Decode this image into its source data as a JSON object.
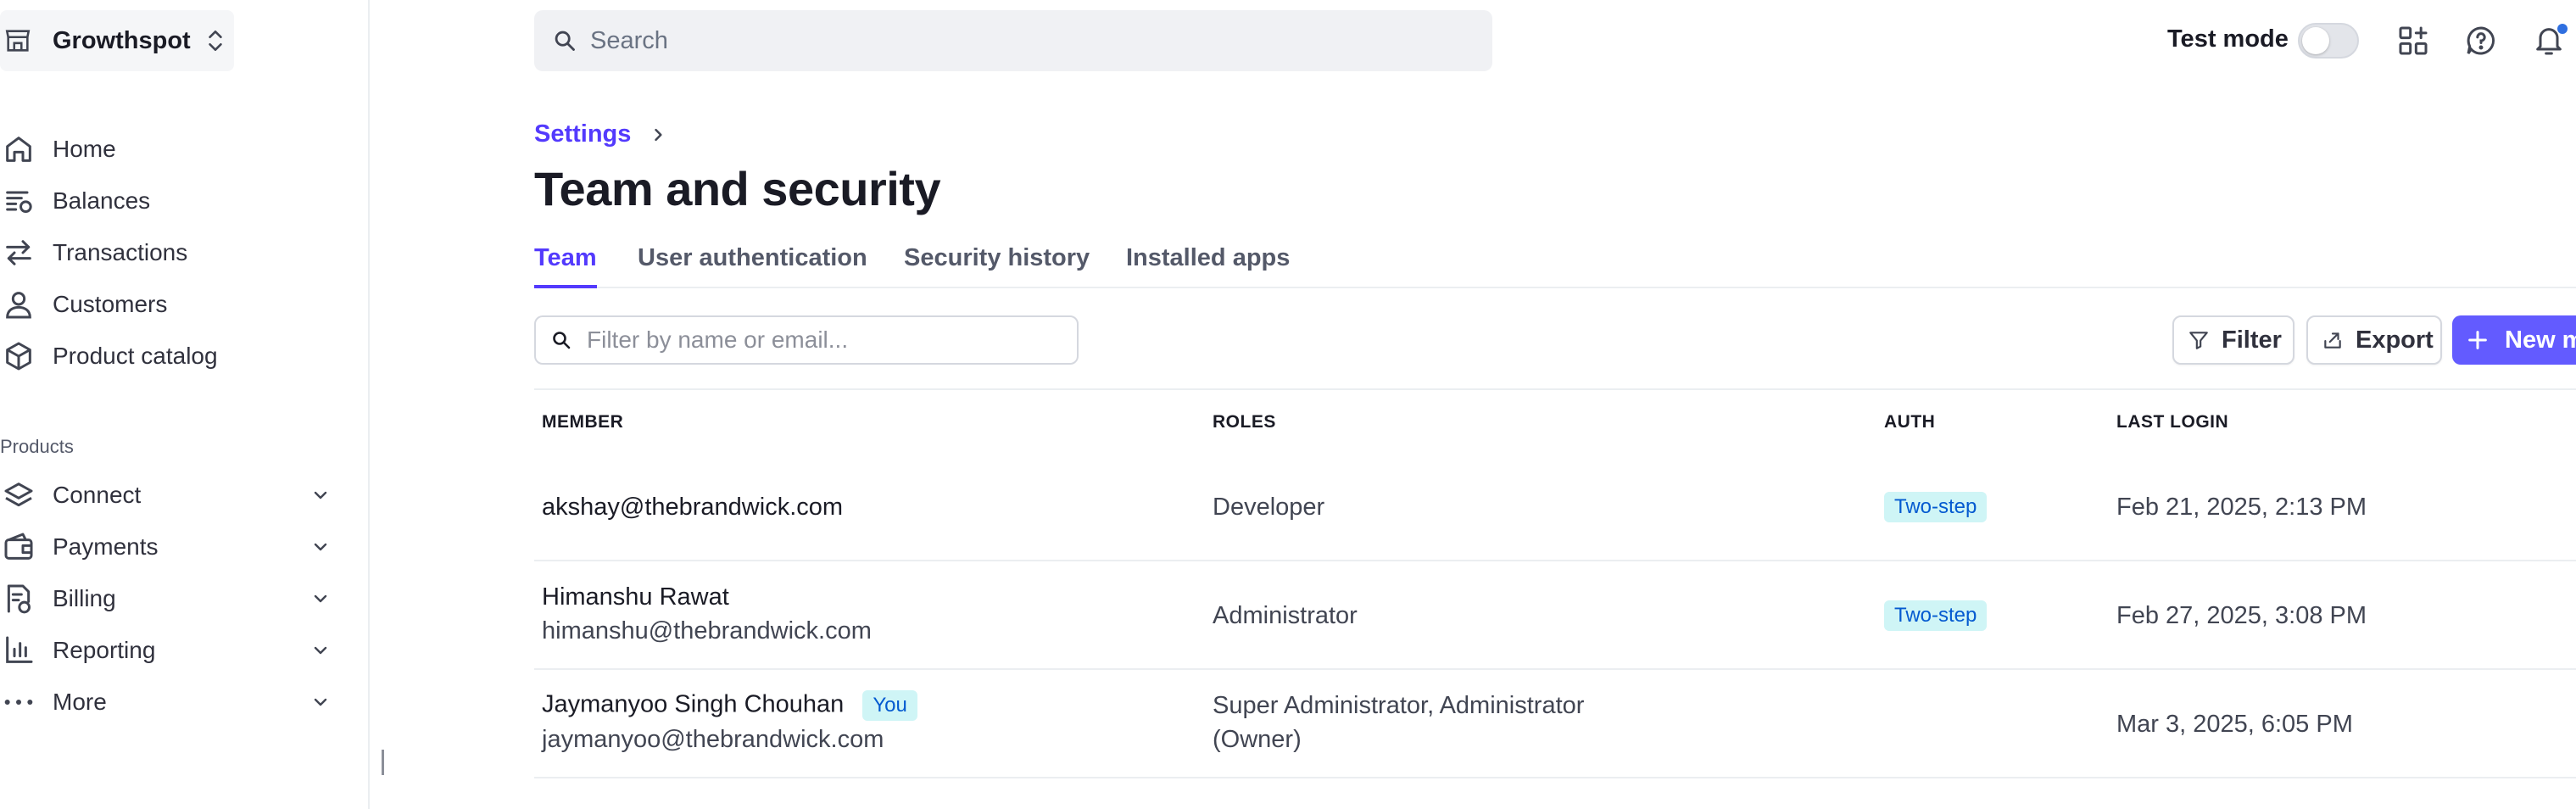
{
  "account": {
    "name": "Growthspot"
  },
  "sidebar": {
    "items": [
      {
        "label": "Home"
      },
      {
        "label": "Balances"
      },
      {
        "label": "Transactions"
      },
      {
        "label": "Customers"
      },
      {
        "label": "Product catalog"
      }
    ],
    "products_section_label": "Products",
    "product_items": [
      {
        "label": "Connect"
      },
      {
        "label": "Payments"
      },
      {
        "label": "Billing"
      },
      {
        "label": "Reporting"
      },
      {
        "label": "More"
      }
    ]
  },
  "topbar": {
    "search_placeholder": "Search",
    "test_mode_label": "Test mode",
    "test_mode_on": false
  },
  "breadcrumb": {
    "parent": "Settings"
  },
  "page": {
    "title": "Team and security"
  },
  "tabs": [
    {
      "label": "Team",
      "active": true
    },
    {
      "label": "User authentication",
      "active": false
    },
    {
      "label": "Security history",
      "active": false
    },
    {
      "label": "Installed apps",
      "active": false
    }
  ],
  "toolbar": {
    "filter_placeholder": "Filter by name or email...",
    "filter_label": "Filter",
    "export_label": "Export",
    "new_member_label": "New m"
  },
  "table": {
    "columns": [
      "MEMBER",
      "ROLES",
      "AUTH",
      "LAST LOGIN"
    ],
    "rows": [
      {
        "name": "",
        "email": "akshay@thebrandwick.com",
        "roles": [
          "Developer"
        ],
        "auth": "Two-step",
        "last_login": "Feb 21, 2025, 2:13 PM"
      },
      {
        "name": "Himanshu Rawat",
        "email": "himanshu@thebrandwick.com",
        "roles": [
          "Administrator"
        ],
        "auth": "Two-step",
        "last_login": "Feb 27, 2025, 3:08 PM"
      },
      {
        "name": "Jaymanyoo Singh Chouhan",
        "you_badge": "You",
        "email": "jaymanyoo@thebrandwick.com",
        "roles": [
          "Super Administrator, Administrator",
          "(Owner)"
        ],
        "auth": "",
        "last_login": "Mar 3, 2025, 6:05 PM"
      }
    ]
  },
  "colors": {
    "accent": "#533afd",
    "primary_button": "#635bff",
    "badge_bg": "#cff5f6",
    "badge_text": "#045ad0"
  }
}
